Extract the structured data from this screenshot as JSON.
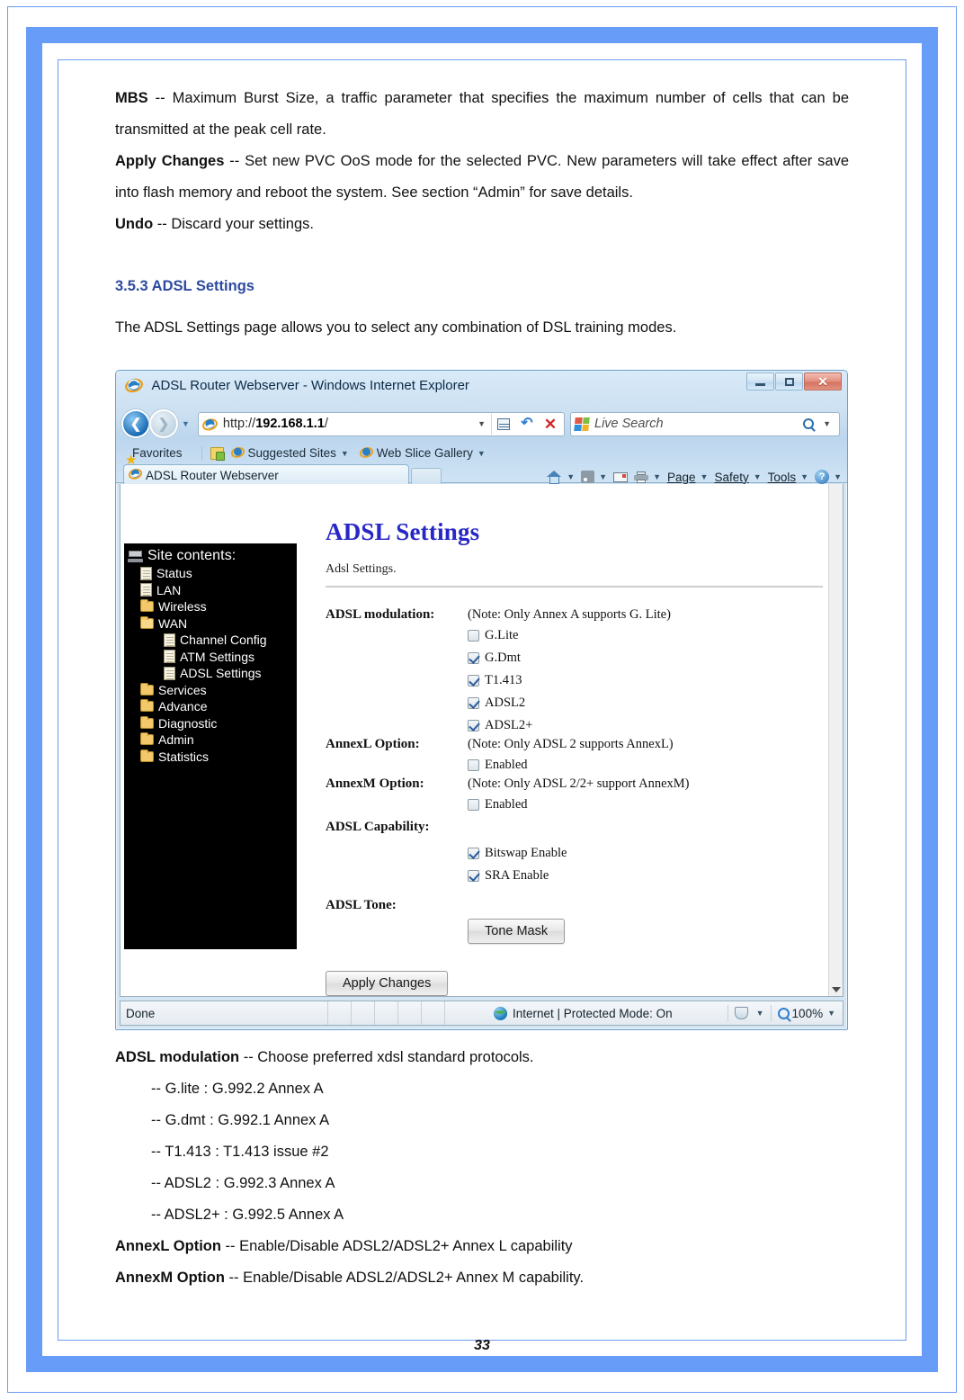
{
  "document": {
    "paragraphs": [
      {
        "term": "MBS",
        "text": " -- Maximum Burst Size, a traffic parameter that specifies the maximum number of cells that can be transmitted at the peak cell rate."
      },
      {
        "term": "Apply Changes",
        "text": " -- Set new PVC OoS mode for the selected PVC. New parameters will take effect after save into flash memory and reboot the system. See section “Admin” for save details."
      },
      {
        "term": "Undo",
        "text": " -- Discard your settings."
      }
    ],
    "section_heading": "3.5.3 ADSL Settings",
    "section_intro": "The ADSL Settings page allows you to select any combination of DSL training modes.",
    "after_figure": {
      "modulation_term": "ADSL modulation",
      "modulation_text": " -- Choose preferred xdsl standard protocols.",
      "bullets": [
        "-- G.lite : G.992.2 Annex A",
        "-- G.dmt : G.992.1 Annex A",
        "-- T1.413 : T1.413 issue #2",
        "-- ADSL2 : G.992.3 Annex A",
        "-- ADSL2+ : G.992.5 Annex A"
      ],
      "annexl_term": "AnnexL Option",
      "annexl_text": " -- Enable/Disable ADSL2/ADSL2+ Annex L capability",
      "annexm_term": "AnnexM Option",
      "annexm_text": " -- Enable/Disable ADSL2/ADSL2+ Annex M capability."
    },
    "page_number": "33"
  },
  "browser": {
    "title": "ADSL Router Webserver - Windows Internet Explorer",
    "window_controls": {
      "minimize": "–",
      "maximize": "□",
      "close": "✕"
    },
    "address": {
      "url_prefix": "http://",
      "url_host": "192.168.1.1",
      "url_suffix": "/"
    },
    "search_placeholder": "Live Search",
    "favorites": {
      "label": "Favorites",
      "suggested_sites": "Suggested Sites",
      "web_slice_gallery": "Web Slice Gallery"
    },
    "tab_label": "ADSL Router Webserver",
    "command_bar": {
      "page": "Page",
      "safety": "Safety",
      "tools": "Tools"
    },
    "status": {
      "done": "Done",
      "zone": "Internet | Protected Mode: On",
      "zoom": "100%"
    }
  },
  "sitetree": {
    "root": "Site contents:",
    "items": [
      {
        "label": "Status",
        "icon": "doc-icon",
        "level": 1
      },
      {
        "label": "LAN",
        "icon": "doc-icon",
        "level": 1
      },
      {
        "label": "Wireless",
        "icon": "folder-icon",
        "level": 1
      },
      {
        "label": "WAN",
        "icon": "folder-open-icon",
        "level": 1
      },
      {
        "label": "Channel Config",
        "icon": "doc-icon",
        "level": 2
      },
      {
        "label": "ATM Settings",
        "icon": "doc-icon",
        "level": 2
      },
      {
        "label": "ADSL Settings",
        "icon": "doc-icon",
        "level": 2
      },
      {
        "label": "Services",
        "icon": "folder-icon",
        "level": 1
      },
      {
        "label": "Advance",
        "icon": "folder-icon",
        "level": 1
      },
      {
        "label": "Diagnostic",
        "icon": "folder-icon",
        "level": 1
      },
      {
        "label": "Admin",
        "icon": "folder-icon",
        "level": 1
      },
      {
        "label": "Statistics",
        "icon": "folder-icon",
        "level": 1
      }
    ]
  },
  "router_page": {
    "title": "ADSL Settings",
    "subtitle": "Adsl Settings.",
    "modulation": {
      "label": "ADSL modulation:",
      "note": "(Note: Only Annex A supports G. Lite)",
      "options": [
        {
          "label": "G.Lite",
          "checked": false
        },
        {
          "label": "G.Dmt",
          "checked": true
        },
        {
          "label": "T1.413",
          "checked": true
        },
        {
          "label": "ADSL2",
          "checked": true
        },
        {
          "label": "ADSL2+",
          "checked": true
        }
      ]
    },
    "annexl": {
      "label": "AnnexL Option:",
      "note": "(Note: Only ADSL 2 supports AnnexL)",
      "option": {
        "label": "Enabled",
        "checked": false
      }
    },
    "annexm": {
      "label": "AnnexM Option:",
      "note": "(Note: Only ADSL 2/2+ support AnnexM)",
      "option": {
        "label": "Enabled",
        "checked": false
      }
    },
    "capability": {
      "label": "ADSL Capability:",
      "options": [
        {
          "label": "Bitswap Enable",
          "checked": true
        },
        {
          "label": "SRA Enable",
          "checked": true
        }
      ]
    },
    "tone": {
      "label": "ADSL Tone:",
      "button": "Tone Mask"
    },
    "apply_button": "Apply Changes"
  },
  "colors": {
    "frame_blue": "#689cf9",
    "heading_blue": "#2c4a9e",
    "router_title_blue": "#2727c6"
  }
}
